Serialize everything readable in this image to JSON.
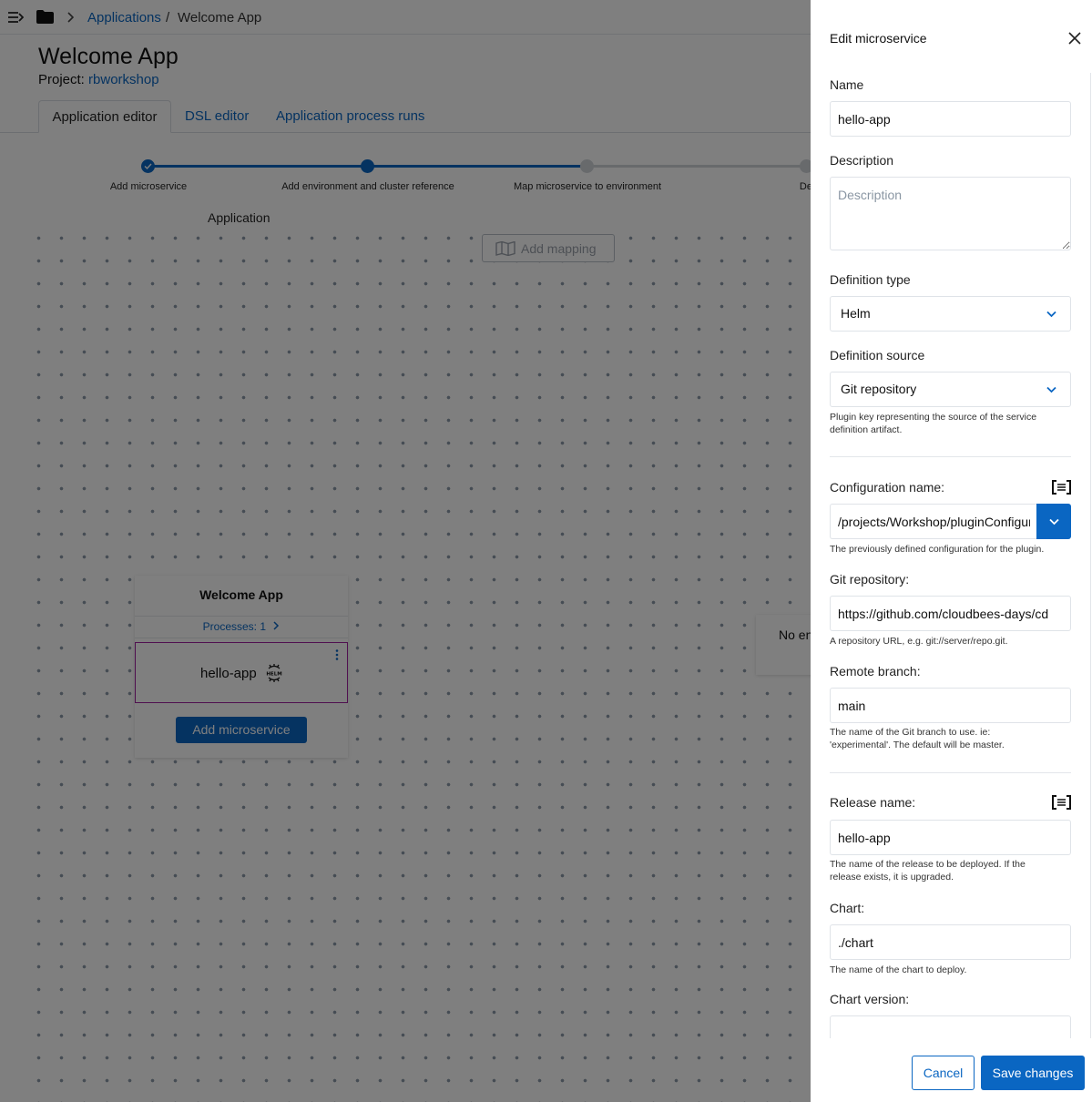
{
  "breadcrumb": {
    "parent": "Applications",
    "separator": "/",
    "current": "Welcome App"
  },
  "header": {
    "title": "Welcome App",
    "project_label": "Project:",
    "project_name": "rbworkshop"
  },
  "tabs": [
    {
      "label": "Application editor",
      "active": true
    },
    {
      "label": "DSL editor",
      "active": false
    },
    {
      "label": "Application process runs",
      "active": false
    }
  ],
  "stepper": {
    "steps": [
      {
        "label": "Add microservice",
        "state": "completed"
      },
      {
        "label": "Add environment and cluster reference",
        "state": "current"
      },
      {
        "label": "Map microservice to environment",
        "state": "pending"
      },
      {
        "label": "Dep",
        "state": "pending"
      }
    ]
  },
  "canvas": {
    "title": "Application",
    "add_mapping_label": "Add mapping",
    "app_card": {
      "title": "Welcome App",
      "processes_label": "Processes: 1",
      "microservice_name": "hello-app",
      "microservice_type_icon": "helm-icon",
      "add_microservice_label": "Add microservice"
    },
    "env_card_text": "No en"
  },
  "drawer": {
    "title": "Edit microservice",
    "name": {
      "label": "Name",
      "value": "hello-app"
    },
    "description": {
      "label": "Description",
      "value": "",
      "placeholder": "Description"
    },
    "definition_type": {
      "label": "Definition type",
      "value": "Helm"
    },
    "definition_source": {
      "label": "Definition source",
      "value": "Git repository",
      "help": "Plugin key representing the source of the service definition artifact."
    },
    "configuration_name": {
      "label": "Configuration name:",
      "value": "/projects/Workshop/pluginConfigurations",
      "help": "The previously defined configuration for the plugin."
    },
    "git_repository": {
      "label": "Git repository:",
      "value": "https://github.com/cloudbees-days/cd",
      "help": "A repository URL, e.g. git://server/repo.git."
    },
    "remote_branch": {
      "label": "Remote branch:",
      "value": "main",
      "help": "The name of the Git branch to use. ie: 'experimental'. The default will be master."
    },
    "release_name": {
      "label": "Release name:",
      "value": "hello-app",
      "help": "The name of the release to be deployed. If the release exists, it is upgraded."
    },
    "chart": {
      "label": "Chart:",
      "value": "./chart",
      "help": "The name of the chart to deploy."
    },
    "chart_version": {
      "label": "Chart version:",
      "value": ""
    },
    "cancel_label": "Cancel",
    "save_label": "Save changes"
  },
  "colors": {
    "accent": "#0a66c2",
    "overlay": "rgba(0,0,0,0.5)",
    "selected_border": "#a020a0"
  }
}
